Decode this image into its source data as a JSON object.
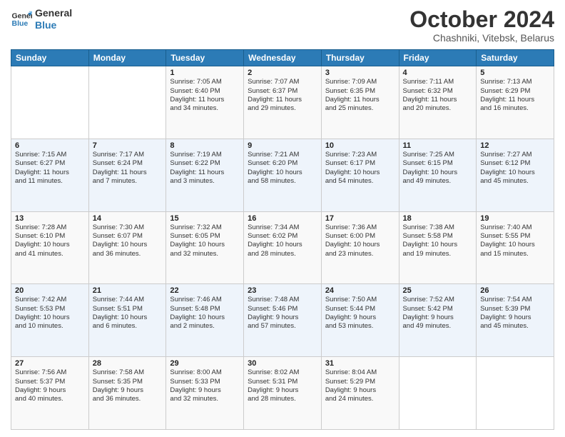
{
  "header": {
    "logo_line1": "General",
    "logo_line2": "Blue",
    "month": "October 2024",
    "location": "Chashniki, Vitebsk, Belarus"
  },
  "weekdays": [
    "Sunday",
    "Monday",
    "Tuesday",
    "Wednesday",
    "Thursday",
    "Friday",
    "Saturday"
  ],
  "weeks": [
    [
      {
        "day": "",
        "info": ""
      },
      {
        "day": "",
        "info": ""
      },
      {
        "day": "1",
        "info": "Sunrise: 7:05 AM\nSunset: 6:40 PM\nDaylight: 11 hours\nand 34 minutes."
      },
      {
        "day": "2",
        "info": "Sunrise: 7:07 AM\nSunset: 6:37 PM\nDaylight: 11 hours\nand 29 minutes."
      },
      {
        "day": "3",
        "info": "Sunrise: 7:09 AM\nSunset: 6:35 PM\nDaylight: 11 hours\nand 25 minutes."
      },
      {
        "day": "4",
        "info": "Sunrise: 7:11 AM\nSunset: 6:32 PM\nDaylight: 11 hours\nand 20 minutes."
      },
      {
        "day": "5",
        "info": "Sunrise: 7:13 AM\nSunset: 6:29 PM\nDaylight: 11 hours\nand 16 minutes."
      }
    ],
    [
      {
        "day": "6",
        "info": "Sunrise: 7:15 AM\nSunset: 6:27 PM\nDaylight: 11 hours\nand 11 minutes."
      },
      {
        "day": "7",
        "info": "Sunrise: 7:17 AM\nSunset: 6:24 PM\nDaylight: 11 hours\nand 7 minutes."
      },
      {
        "day": "8",
        "info": "Sunrise: 7:19 AM\nSunset: 6:22 PM\nDaylight: 11 hours\nand 3 minutes."
      },
      {
        "day": "9",
        "info": "Sunrise: 7:21 AM\nSunset: 6:20 PM\nDaylight: 10 hours\nand 58 minutes."
      },
      {
        "day": "10",
        "info": "Sunrise: 7:23 AM\nSunset: 6:17 PM\nDaylight: 10 hours\nand 54 minutes."
      },
      {
        "day": "11",
        "info": "Sunrise: 7:25 AM\nSunset: 6:15 PM\nDaylight: 10 hours\nand 49 minutes."
      },
      {
        "day": "12",
        "info": "Sunrise: 7:27 AM\nSunset: 6:12 PM\nDaylight: 10 hours\nand 45 minutes."
      }
    ],
    [
      {
        "day": "13",
        "info": "Sunrise: 7:28 AM\nSunset: 6:10 PM\nDaylight: 10 hours\nand 41 minutes."
      },
      {
        "day": "14",
        "info": "Sunrise: 7:30 AM\nSunset: 6:07 PM\nDaylight: 10 hours\nand 36 minutes."
      },
      {
        "day": "15",
        "info": "Sunrise: 7:32 AM\nSunset: 6:05 PM\nDaylight: 10 hours\nand 32 minutes."
      },
      {
        "day": "16",
        "info": "Sunrise: 7:34 AM\nSunset: 6:02 PM\nDaylight: 10 hours\nand 28 minutes."
      },
      {
        "day": "17",
        "info": "Sunrise: 7:36 AM\nSunset: 6:00 PM\nDaylight: 10 hours\nand 23 minutes."
      },
      {
        "day": "18",
        "info": "Sunrise: 7:38 AM\nSunset: 5:58 PM\nDaylight: 10 hours\nand 19 minutes."
      },
      {
        "day": "19",
        "info": "Sunrise: 7:40 AM\nSunset: 5:55 PM\nDaylight: 10 hours\nand 15 minutes."
      }
    ],
    [
      {
        "day": "20",
        "info": "Sunrise: 7:42 AM\nSunset: 5:53 PM\nDaylight: 10 hours\nand 10 minutes."
      },
      {
        "day": "21",
        "info": "Sunrise: 7:44 AM\nSunset: 5:51 PM\nDaylight: 10 hours\nand 6 minutes."
      },
      {
        "day": "22",
        "info": "Sunrise: 7:46 AM\nSunset: 5:48 PM\nDaylight: 10 hours\nand 2 minutes."
      },
      {
        "day": "23",
        "info": "Sunrise: 7:48 AM\nSunset: 5:46 PM\nDaylight: 9 hours\nand 57 minutes."
      },
      {
        "day": "24",
        "info": "Sunrise: 7:50 AM\nSunset: 5:44 PM\nDaylight: 9 hours\nand 53 minutes."
      },
      {
        "day": "25",
        "info": "Sunrise: 7:52 AM\nSunset: 5:42 PM\nDaylight: 9 hours\nand 49 minutes."
      },
      {
        "day": "26",
        "info": "Sunrise: 7:54 AM\nSunset: 5:39 PM\nDaylight: 9 hours\nand 45 minutes."
      }
    ],
    [
      {
        "day": "27",
        "info": "Sunrise: 7:56 AM\nSunset: 5:37 PM\nDaylight: 9 hours\nand 40 minutes."
      },
      {
        "day": "28",
        "info": "Sunrise: 7:58 AM\nSunset: 5:35 PM\nDaylight: 9 hours\nand 36 minutes."
      },
      {
        "day": "29",
        "info": "Sunrise: 8:00 AM\nSunset: 5:33 PM\nDaylight: 9 hours\nand 32 minutes."
      },
      {
        "day": "30",
        "info": "Sunrise: 8:02 AM\nSunset: 5:31 PM\nDaylight: 9 hours\nand 28 minutes."
      },
      {
        "day": "31",
        "info": "Sunrise: 8:04 AM\nSunset: 5:29 PM\nDaylight: 9 hours\nand 24 minutes."
      },
      {
        "day": "",
        "info": ""
      },
      {
        "day": "",
        "info": ""
      }
    ]
  ]
}
